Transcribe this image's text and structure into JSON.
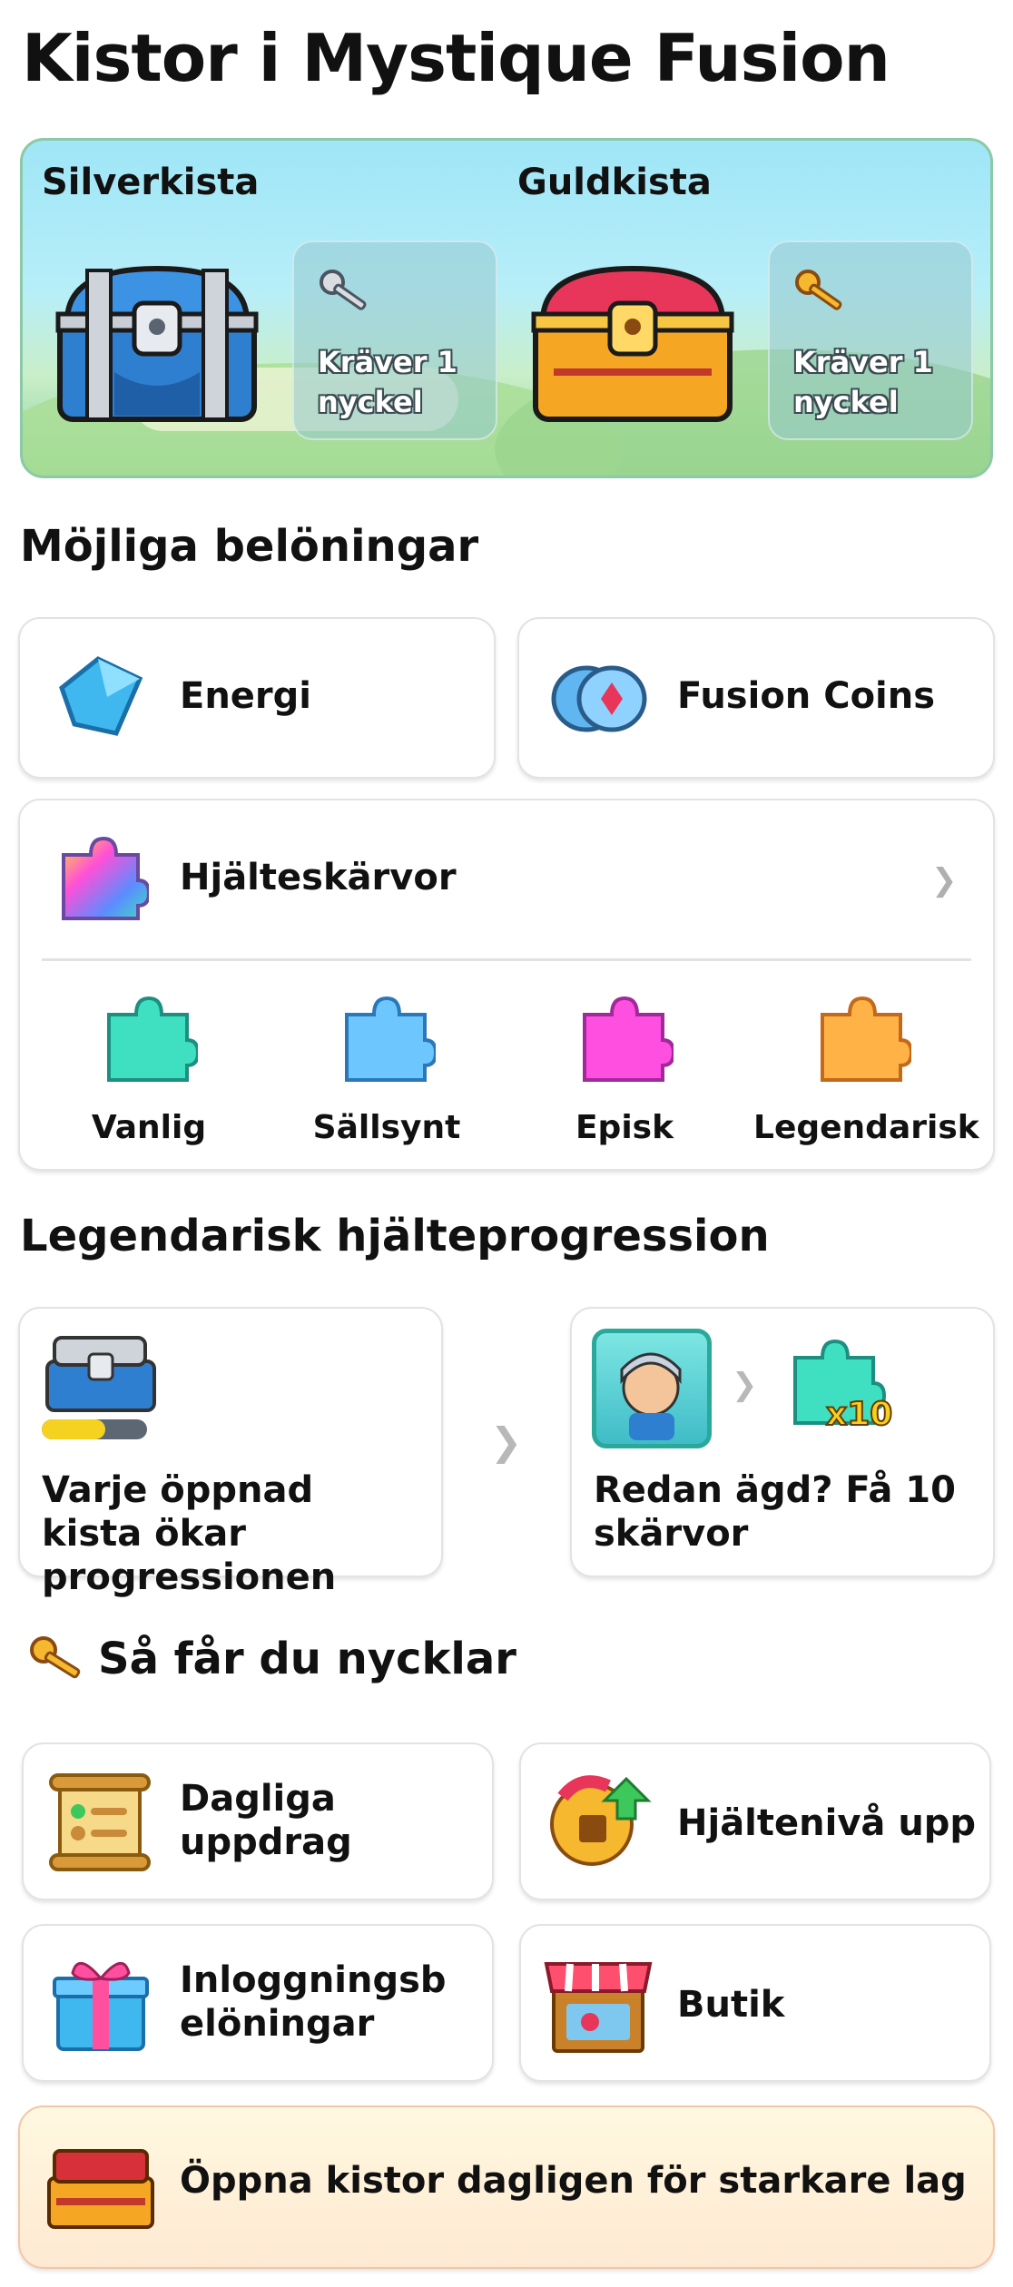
{
  "page_title": "Kistor i Mystique Fusion",
  "hero": {
    "silver": {
      "label": "Silverkista",
      "requirement": "Kräver 1 nyckel"
    },
    "gold": {
      "label": "Guldkista",
      "requirement": "Kräver 1 nyckel"
    }
  },
  "rewards": {
    "heading": "Möjliga belöningar",
    "energy": "Energi",
    "coins": "Fusion Coins",
    "shards": {
      "label": "Hjälteskärvor",
      "rarities": [
        "Vanlig",
        "Sällsynt",
        "Episk",
        "Legendarisk"
      ]
    }
  },
  "progression": {
    "heading": "Legendarisk hjälteprogression",
    "step1": "Varje öppnad kista ökar progressionen",
    "step2": "Redan ägd? Få 10 skärvor",
    "multiplier": "x10",
    "progress_fraction": 0.6
  },
  "keys": {
    "heading": "Så får du nycklar",
    "sources": [
      "Dagliga uppdrag",
      "Hjältenivå upp",
      "Inloggningsbelöningar",
      "Butik"
    ]
  },
  "banner": {
    "text": "Öppna kistor dagligen för starkare lag"
  },
  "colors": {
    "silver_chest": "#2f7fd0",
    "gold_chest": "#e8365a",
    "accent_yellow": "#f5d21f"
  }
}
